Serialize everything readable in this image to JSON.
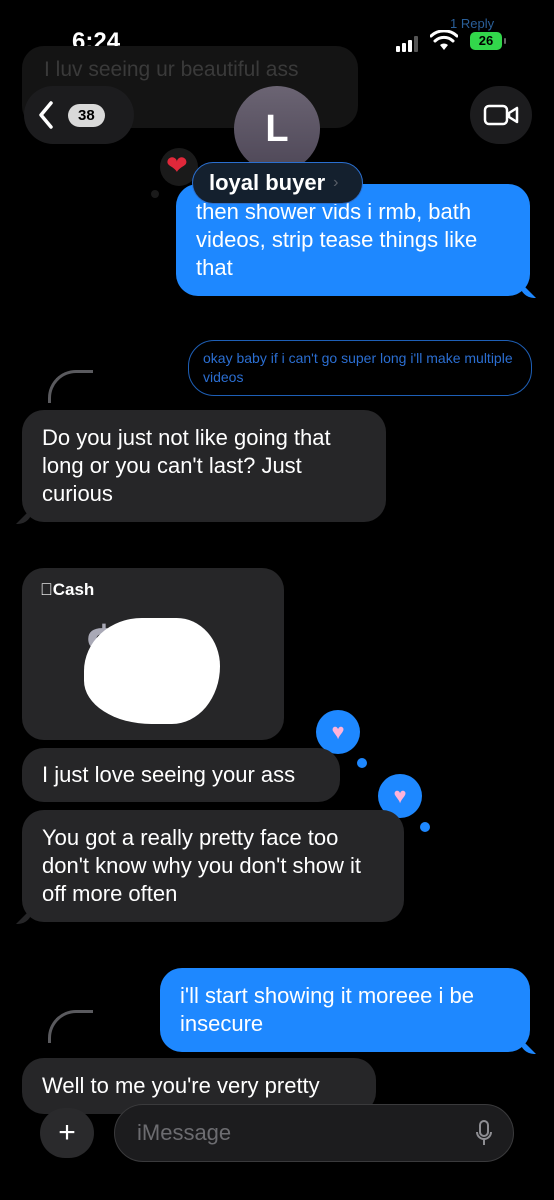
{
  "status_bar": {
    "time": "6:24",
    "battery": "26"
  },
  "header": {
    "back_count": "38",
    "avatar_initial": "L",
    "contact_name": "loyal buyer",
    "contact_chevron": "›",
    "ghost_reply_label": "1 Reply",
    "ghost_message": "I luv seeing ur beautiful ass"
  },
  "messages": [
    {
      "side": "sent",
      "text": "then shower vids i rmb, bath videos, strip tease things like that"
    },
    {
      "side": "sent-reply",
      "text": "okay baby if i can't go super long i'll make multiple videos"
    },
    {
      "side": "received",
      "text": "Do you just not like going that long or you can't last? Just curious"
    },
    {
      "side": "cash",
      "label": "Cash",
      "symbol": "$"
    },
    {
      "side": "received",
      "text": "I just love seeing your ass"
    },
    {
      "side": "received",
      "text": "You got a really pretty face too don't know why you don't show it off more often"
    },
    {
      "side": "sent",
      "text": "i'll start showing it moreee i be insecure"
    },
    {
      "side": "received",
      "text": "Well to me you're very pretty"
    }
  ],
  "input": {
    "placeholder": "iMessage"
  },
  "icons": {
    "back": "chevron-left-icon",
    "video": "video-camera-icon",
    "plus": "plus-icon",
    "mic": "microphone-icon",
    "heart": "heart-icon"
  },
  "colors": {
    "sent_bubble": "#1e88ff",
    "received_bubble": "#262628",
    "background": "#000000"
  }
}
